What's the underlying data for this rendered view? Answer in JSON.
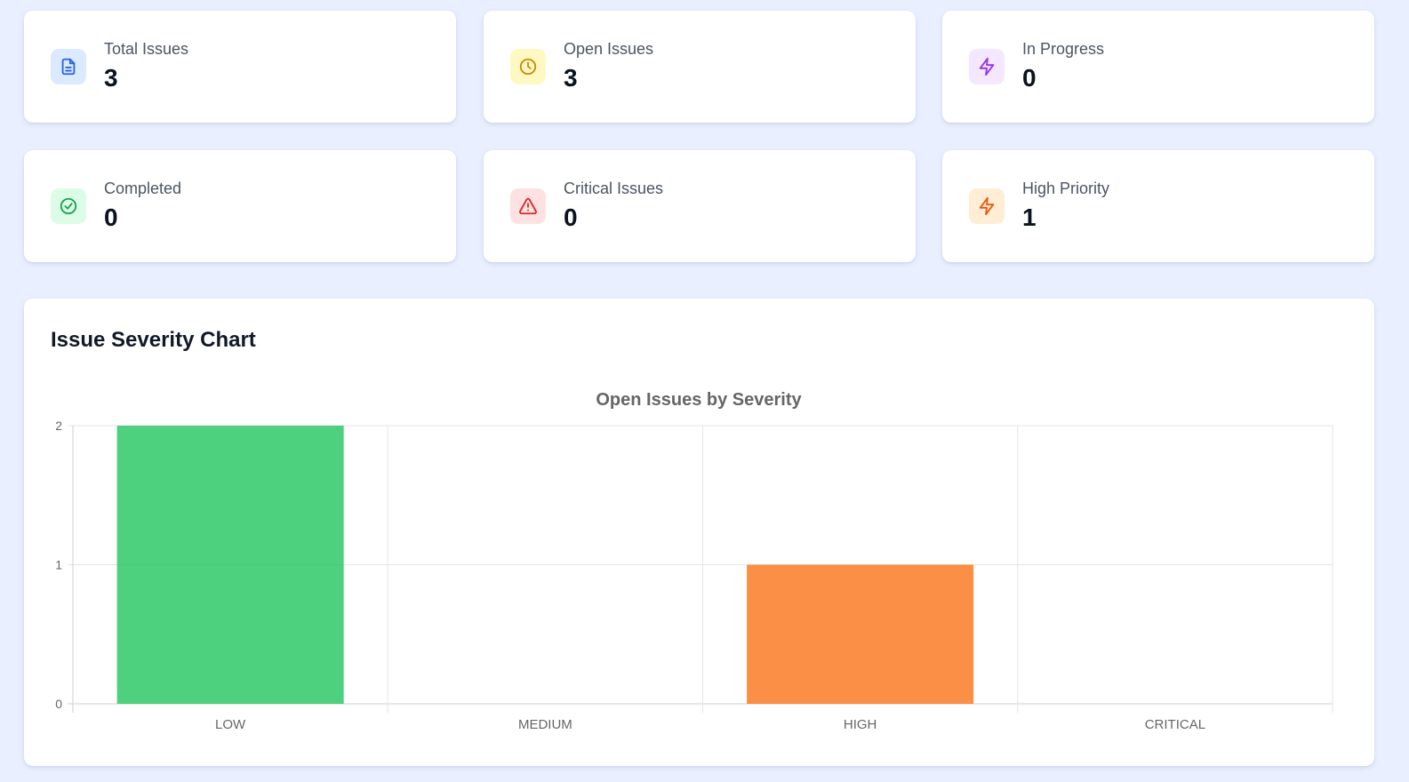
{
  "stats": [
    {
      "label": "Total Issues",
      "value": "3",
      "icon": "document-icon",
      "icon_color": "#2563eb",
      "icon_bg": "#dbeafe"
    },
    {
      "label": "Open Issues",
      "value": "3",
      "icon": "clock-icon",
      "icon_color": "#ca8a04",
      "icon_bg": "#fef9c3"
    },
    {
      "label": "In Progress",
      "value": "0",
      "icon": "lightning-icon",
      "icon_color": "#9333ea",
      "icon_bg": "#f3e8ff"
    },
    {
      "label": "Completed",
      "value": "0",
      "icon": "check-circle-icon",
      "icon_color": "#16a34a",
      "icon_bg": "#dcfce7"
    },
    {
      "label": "Critical Issues",
      "value": "0",
      "icon": "warning-icon",
      "icon_color": "#dc2626",
      "icon_bg": "#fee2e2"
    },
    {
      "label": "High Priority",
      "value": "1",
      "icon": "lightning-icon",
      "icon_color": "#ea580c",
      "icon_bg": "#ffedd5"
    }
  ],
  "chart_section": {
    "heading": "Issue Severity Chart"
  },
  "chart_data": {
    "type": "bar",
    "title": "Open Issues by Severity",
    "categories": [
      "LOW",
      "MEDIUM",
      "HIGH",
      "CRITICAL"
    ],
    "values": [
      2,
      0,
      1,
      0
    ],
    "colors": [
      "#22c55e",
      "#eab308",
      "#f97316",
      "#ef4444"
    ],
    "ylim": [
      0,
      2
    ],
    "yticks": [
      0,
      1,
      2
    ],
    "grid": true,
    "xlabel": "",
    "ylabel": ""
  }
}
